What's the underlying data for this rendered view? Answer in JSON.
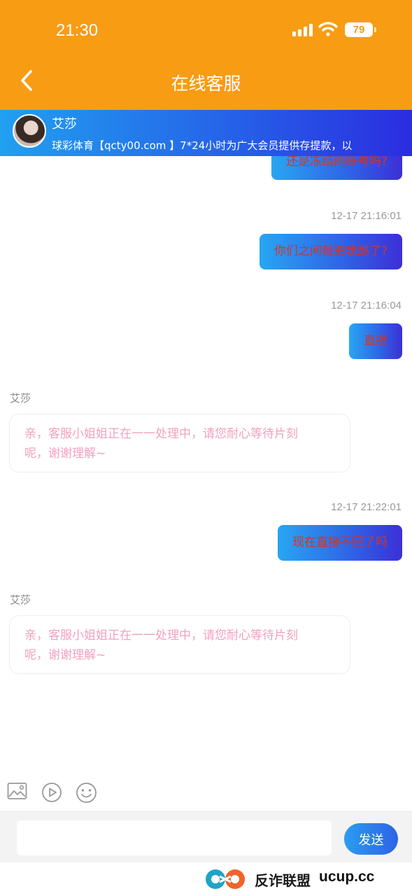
{
  "status_bar": {
    "time": "21:30",
    "battery": "79"
  },
  "header": {
    "title": "在线客服"
  },
  "agent": {
    "name": "艾莎",
    "marquee": "球彩体育【qcty00.com 】7*24小时为广大会员提供存提款，以"
  },
  "messages": [
    {
      "type": "out",
      "text": "还是冻结的账号吗?"
    },
    {
      "type": "out",
      "time": "12-17 21:16:01",
      "text": "你们之间就把我踢了?"
    },
    {
      "type": "out",
      "time": "12-17 21:16:04",
      "text": "直接"
    },
    {
      "type": "in",
      "sender": "艾莎",
      "text_line1": "亲，客服小姐姐正在一一处理中，请您耐心等待片刻",
      "text_line2": "呢，谢谢理解~"
    },
    {
      "type": "out",
      "time": "12-17 21:22:01",
      "text": "现在直接不回了吗"
    },
    {
      "type": "in",
      "sender": "艾莎",
      "text_line1": "亲，客服小姐姐正在一一处理中，请您耐心等待片刻",
      "text_line2": "呢，谢谢理解~"
    }
  ],
  "toolbar": {
    "icons": [
      "image-icon",
      "video-icon",
      "emoji-icon"
    ]
  },
  "composer": {
    "input_value": "",
    "send_label": "发送"
  },
  "watermark": {
    "text": "反诈联盟",
    "domain": "ucup.cc"
  },
  "colors": {
    "header": "#f89c14",
    "banner_start": "#21a0f0",
    "banner_end": "#2b2de0",
    "outgoing_text": "#d9321f",
    "incoming_text": "#f2a0bf"
  }
}
